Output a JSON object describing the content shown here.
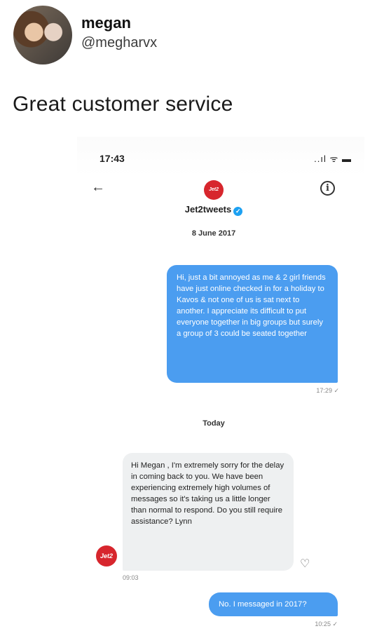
{
  "tweet": {
    "display_name": "megan",
    "handle": "@megharvx",
    "text": "Great customer service"
  },
  "phone": {
    "status_time": "17:43",
    "status_icons": "..ıl ᯤ ▬"
  },
  "conversation": {
    "account_name": "Jet2tweets",
    "logo_text": "Jet2",
    "verified_glyph": "✓",
    "back_glyph": "←",
    "info_glyph": "i",
    "react_glyph": "♡",
    "messages": [
      {
        "date_divider": "8 June 2017",
        "direction": "outgoing",
        "text": "Hi, just a bit annoyed as me & 2 girl friends have just online checked in for a holiday to Kavos & not one of us is sat next to another. I appreciate its difficult to put everyone together in big groups but surely a group of 3 could be seated together",
        "time": "17:29 ✓"
      },
      {
        "date_divider": "Today",
        "direction": "incoming",
        "text": "Hi Megan , I'm extremely sorry for the delay in coming back to you. We have been experiencing extremely high volumes of messages so it's taking us a little longer than normal to respond. Do you still require assistance? Lynn",
        "time": "09:03"
      },
      {
        "direction": "outgoing",
        "text": "No. I messaged in 2017?",
        "time": "10:25 ✓"
      }
    ]
  }
}
